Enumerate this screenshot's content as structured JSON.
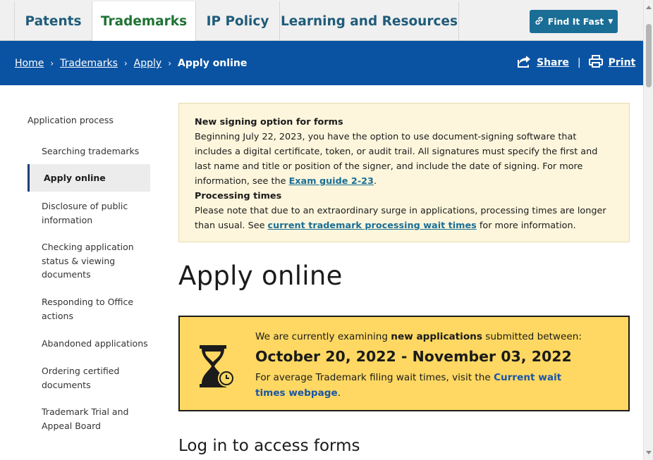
{
  "nav": {
    "tabs": [
      {
        "label": "Patents"
      },
      {
        "label": "Trademarks"
      },
      {
        "label": "IP Policy"
      },
      {
        "label": "Learning and Resources"
      }
    ],
    "find_fast": "Find It Fast"
  },
  "breadcrumb": {
    "items": [
      "Home",
      "Trademarks",
      "Apply"
    ],
    "current": "Apply online",
    "separator": "›"
  },
  "actions": {
    "share": "Share",
    "print": "Print"
  },
  "sidebar": {
    "heading": "Application process",
    "items": [
      {
        "label": "Searching trademarks"
      },
      {
        "label": "Apply online"
      },
      {
        "label": "Disclosure of public information"
      },
      {
        "label": "Checking application status & viewing documents"
      },
      {
        "label": "Responding to Office actions"
      },
      {
        "label": "Abandoned applications"
      },
      {
        "label": "Ordering certified documents"
      },
      {
        "label": "Trademark Trial and Appeal Board"
      }
    ]
  },
  "notice": {
    "title1": "New signing option for forms",
    "body1": "Beginning July 22, 2023, you have the option to use document-signing software that includes a digital certificate, token, or audit trail. All signatures must specify the first and last name and title or position of the signer, and include the date of signing. For more information, see the",
    "link1": "Exam guide 2-23",
    "title2": "Processing times",
    "body2a": "Please note that due to an extraordinary surge in applications, processing times are longer than usual. See",
    "link2": "current trademark processing wait times",
    "body2b": "for more information."
  },
  "page_title": "Apply online",
  "exam": {
    "pre": "We are currently examining",
    "strong": "new applications",
    "post": "submitted between:",
    "dates": "October 20, 2022 - November 03, 2022",
    "wait_pre": "For average Trademark filing wait times, visit the",
    "wait_link": "Current wait times webpage"
  },
  "section_title": "Log in to access forms",
  "colors": {
    "brand_blue": "#0a53a2",
    "accent_green": "#1e7333",
    "banner_yellow": "#fed862"
  }
}
